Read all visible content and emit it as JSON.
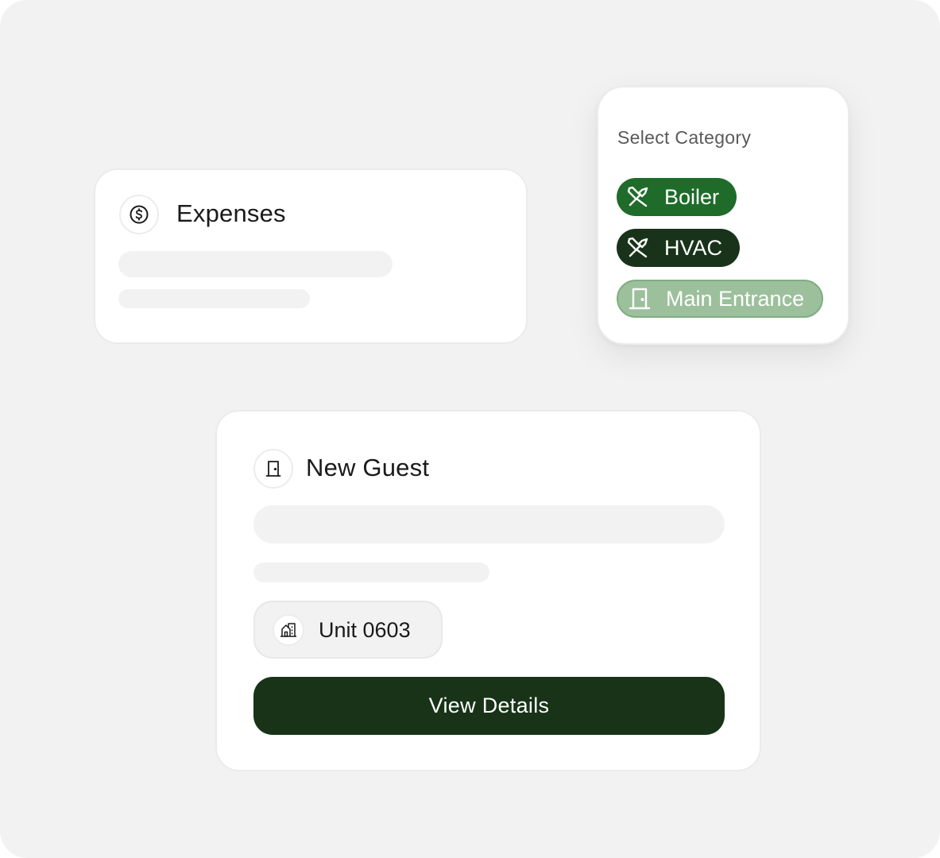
{
  "expenses_card": {
    "title": "Expenses",
    "icon": "dollar-circle-icon"
  },
  "category_card": {
    "heading": "Select Category",
    "options": [
      {
        "label": "Boiler",
        "icon": "tools-icon",
        "color": "#1f6b2a"
      },
      {
        "label": "HVAC",
        "icon": "tools-icon",
        "color": "#18331a"
      },
      {
        "label": "Main Entrance",
        "icon": "door-icon",
        "color": "#9cbf9c"
      }
    ]
  },
  "guest_card": {
    "title": "New Guest",
    "icon": "door-icon",
    "unit": {
      "label": "Unit 0603",
      "icon": "building-icon"
    },
    "action_label": "View Details",
    "action_color": "#183318"
  },
  "colors": {
    "background": "#f2f2f2",
    "card": "#ffffff",
    "skeleton": "#f2f2f2"
  }
}
